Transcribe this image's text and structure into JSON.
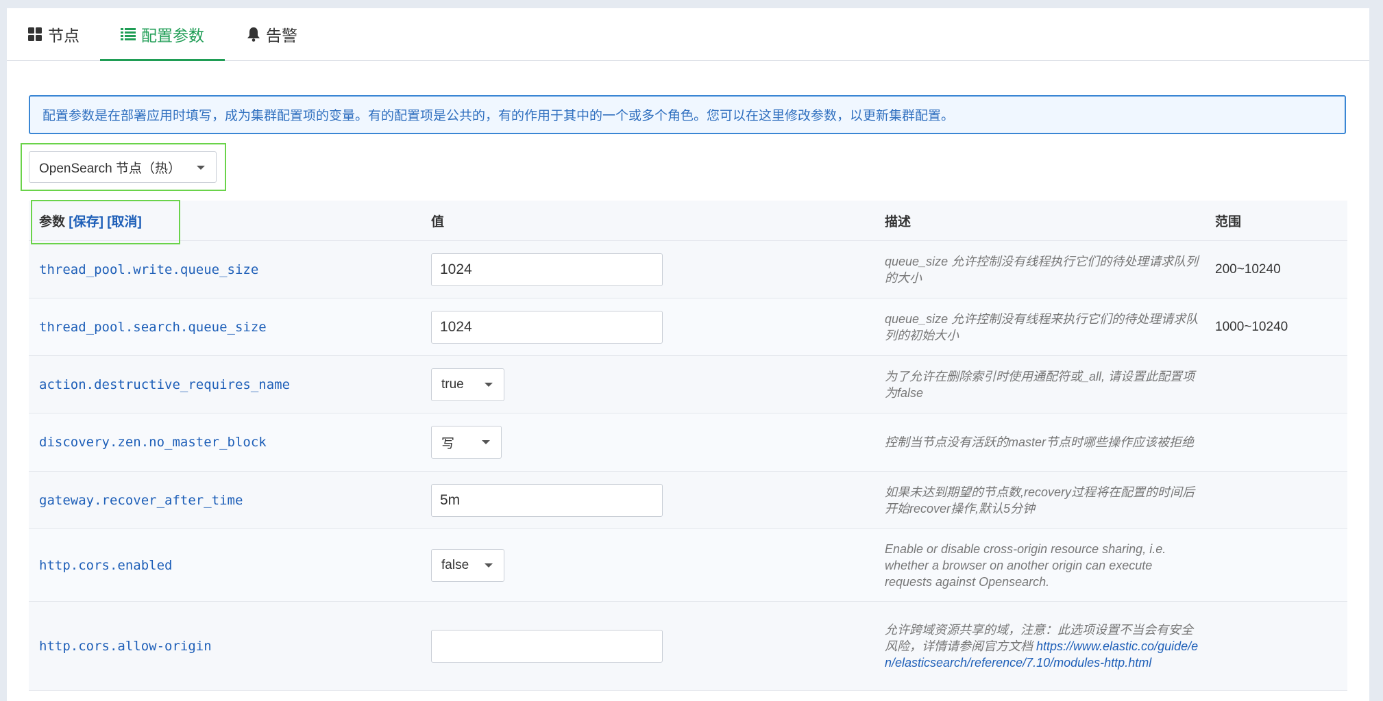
{
  "tabs": [
    {
      "label": "节点",
      "icon": "grid-icon"
    },
    {
      "label": "配置参数",
      "icon": "list-icon"
    },
    {
      "label": "告警",
      "icon": "bell-icon"
    }
  ],
  "active_tab": "配置参数",
  "notice": "配置参数是在部署应用时填写，成为集群配置项的变量。有的配置项是公共的，有的作用于其中的一个或多个角色。您可以在这里修改参数，以更新集群配置。",
  "role_select": {
    "value": "OpenSearch 节点（热）"
  },
  "table": {
    "headers": {
      "param": "参数",
      "save": "[保存]",
      "cancel": "[取消]",
      "value": "值",
      "desc": "描述",
      "range": "范围"
    },
    "rows": [
      {
        "name": "thread_pool.write.queue_size",
        "value": "1024",
        "desc": "queue_size 允许控制没有线程执行它们的待处理请求队列的大小",
        "range": "200~10240"
      },
      {
        "name": "thread_pool.search.queue_size",
        "value": "1024",
        "desc": "queue_size 允许控制没有线程来执行它们的待处理请求队列的初始大小",
        "range": "1000~10240"
      },
      {
        "name": "action.destructive_requires_name",
        "value": "true",
        "desc": "为了允许在删除索引时使用通配符或_all, 请设置此配置项为false",
        "range": ""
      },
      {
        "name": "discovery.zen.no_master_block",
        "value": "写",
        "desc": "控制当节点没有活跃的master节点时哪些操作应该被拒绝",
        "range": ""
      },
      {
        "name": "gateway.recover_after_time",
        "value": "5m",
        "desc": "如果未达到期望的节点数,recovery过程将在配置的时间后开始recover操作,默认5分钟",
        "range": ""
      },
      {
        "name": "http.cors.enabled",
        "value": "false",
        "desc": "Enable or disable cross-origin resource sharing, i.e. whether a browser on another origin can execute requests against Opensearch.",
        "range": ""
      },
      {
        "name": "http.cors.allow-origin",
        "value": "",
        "desc": "允许跨域资源共享的域，注意：此选项设置不当会有安全风险，详情请参阅官方文档 ",
        "desc_link": "https://www.elastic.co/guide/en/elasticsearch/reference/7.10/modules-http.html",
        "range": ""
      }
    ]
  },
  "colors": {
    "accent": "#1f9d55",
    "link": "#1e5fb8",
    "notice_border": "#3a86d4",
    "highlight": "#6ad34a"
  }
}
